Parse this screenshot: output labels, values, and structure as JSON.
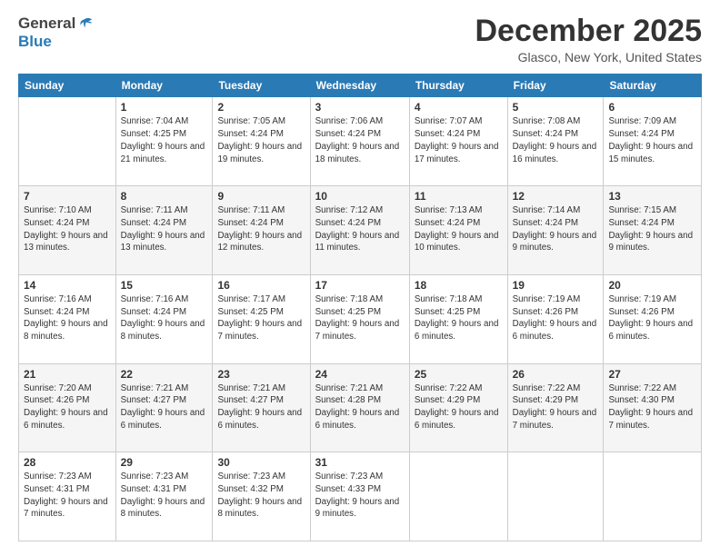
{
  "header": {
    "logo_line1": "General",
    "logo_line2": "Blue",
    "month_title": "December 2025",
    "location": "Glasco, New York, United States"
  },
  "days_of_week": [
    "Sunday",
    "Monday",
    "Tuesday",
    "Wednesday",
    "Thursday",
    "Friday",
    "Saturday"
  ],
  "weeks": [
    [
      {
        "day": "",
        "sunrise": "",
        "sunset": "",
        "daylight": ""
      },
      {
        "day": "1",
        "sunrise": "Sunrise: 7:04 AM",
        "sunset": "Sunset: 4:25 PM",
        "daylight": "Daylight: 9 hours and 21 minutes."
      },
      {
        "day": "2",
        "sunrise": "Sunrise: 7:05 AM",
        "sunset": "Sunset: 4:24 PM",
        "daylight": "Daylight: 9 hours and 19 minutes."
      },
      {
        "day": "3",
        "sunrise": "Sunrise: 7:06 AM",
        "sunset": "Sunset: 4:24 PM",
        "daylight": "Daylight: 9 hours and 18 minutes."
      },
      {
        "day": "4",
        "sunrise": "Sunrise: 7:07 AM",
        "sunset": "Sunset: 4:24 PM",
        "daylight": "Daylight: 9 hours and 17 minutes."
      },
      {
        "day": "5",
        "sunrise": "Sunrise: 7:08 AM",
        "sunset": "Sunset: 4:24 PM",
        "daylight": "Daylight: 9 hours and 16 minutes."
      },
      {
        "day": "6",
        "sunrise": "Sunrise: 7:09 AM",
        "sunset": "Sunset: 4:24 PM",
        "daylight": "Daylight: 9 hours and 15 minutes."
      }
    ],
    [
      {
        "day": "7",
        "sunrise": "Sunrise: 7:10 AM",
        "sunset": "Sunset: 4:24 PM",
        "daylight": "Daylight: 9 hours and 13 minutes."
      },
      {
        "day": "8",
        "sunrise": "Sunrise: 7:11 AM",
        "sunset": "Sunset: 4:24 PM",
        "daylight": "Daylight: 9 hours and 13 minutes."
      },
      {
        "day": "9",
        "sunrise": "Sunrise: 7:11 AM",
        "sunset": "Sunset: 4:24 PM",
        "daylight": "Daylight: 9 hours and 12 minutes."
      },
      {
        "day": "10",
        "sunrise": "Sunrise: 7:12 AM",
        "sunset": "Sunset: 4:24 PM",
        "daylight": "Daylight: 9 hours and 11 minutes."
      },
      {
        "day": "11",
        "sunrise": "Sunrise: 7:13 AM",
        "sunset": "Sunset: 4:24 PM",
        "daylight": "Daylight: 9 hours and 10 minutes."
      },
      {
        "day": "12",
        "sunrise": "Sunrise: 7:14 AM",
        "sunset": "Sunset: 4:24 PM",
        "daylight": "Daylight: 9 hours and 9 minutes."
      },
      {
        "day": "13",
        "sunrise": "Sunrise: 7:15 AM",
        "sunset": "Sunset: 4:24 PM",
        "daylight": "Daylight: 9 hours and 9 minutes."
      }
    ],
    [
      {
        "day": "14",
        "sunrise": "Sunrise: 7:16 AM",
        "sunset": "Sunset: 4:24 PM",
        "daylight": "Daylight: 9 hours and 8 minutes."
      },
      {
        "day": "15",
        "sunrise": "Sunrise: 7:16 AM",
        "sunset": "Sunset: 4:24 PM",
        "daylight": "Daylight: 9 hours and 8 minutes."
      },
      {
        "day": "16",
        "sunrise": "Sunrise: 7:17 AM",
        "sunset": "Sunset: 4:25 PM",
        "daylight": "Daylight: 9 hours and 7 minutes."
      },
      {
        "day": "17",
        "sunrise": "Sunrise: 7:18 AM",
        "sunset": "Sunset: 4:25 PM",
        "daylight": "Daylight: 9 hours and 7 minutes."
      },
      {
        "day": "18",
        "sunrise": "Sunrise: 7:18 AM",
        "sunset": "Sunset: 4:25 PM",
        "daylight": "Daylight: 9 hours and 6 minutes."
      },
      {
        "day": "19",
        "sunrise": "Sunrise: 7:19 AM",
        "sunset": "Sunset: 4:26 PM",
        "daylight": "Daylight: 9 hours and 6 minutes."
      },
      {
        "day": "20",
        "sunrise": "Sunrise: 7:19 AM",
        "sunset": "Sunset: 4:26 PM",
        "daylight": "Daylight: 9 hours and 6 minutes."
      }
    ],
    [
      {
        "day": "21",
        "sunrise": "Sunrise: 7:20 AM",
        "sunset": "Sunset: 4:26 PM",
        "daylight": "Daylight: 9 hours and 6 minutes."
      },
      {
        "day": "22",
        "sunrise": "Sunrise: 7:21 AM",
        "sunset": "Sunset: 4:27 PM",
        "daylight": "Daylight: 9 hours and 6 minutes."
      },
      {
        "day": "23",
        "sunrise": "Sunrise: 7:21 AM",
        "sunset": "Sunset: 4:27 PM",
        "daylight": "Daylight: 9 hours and 6 minutes."
      },
      {
        "day": "24",
        "sunrise": "Sunrise: 7:21 AM",
        "sunset": "Sunset: 4:28 PM",
        "daylight": "Daylight: 9 hours and 6 minutes."
      },
      {
        "day": "25",
        "sunrise": "Sunrise: 7:22 AM",
        "sunset": "Sunset: 4:29 PM",
        "daylight": "Daylight: 9 hours and 6 minutes."
      },
      {
        "day": "26",
        "sunrise": "Sunrise: 7:22 AM",
        "sunset": "Sunset: 4:29 PM",
        "daylight": "Daylight: 9 hours and 7 minutes."
      },
      {
        "day": "27",
        "sunrise": "Sunrise: 7:22 AM",
        "sunset": "Sunset: 4:30 PM",
        "daylight": "Daylight: 9 hours and 7 minutes."
      }
    ],
    [
      {
        "day": "28",
        "sunrise": "Sunrise: 7:23 AM",
        "sunset": "Sunset: 4:31 PM",
        "daylight": "Daylight: 9 hours and 7 minutes."
      },
      {
        "day": "29",
        "sunrise": "Sunrise: 7:23 AM",
        "sunset": "Sunset: 4:31 PM",
        "daylight": "Daylight: 9 hours and 8 minutes."
      },
      {
        "day": "30",
        "sunrise": "Sunrise: 7:23 AM",
        "sunset": "Sunset: 4:32 PM",
        "daylight": "Daylight: 9 hours and 8 minutes."
      },
      {
        "day": "31",
        "sunrise": "Sunrise: 7:23 AM",
        "sunset": "Sunset: 4:33 PM",
        "daylight": "Daylight: 9 hours and 9 minutes."
      },
      {
        "day": "",
        "sunrise": "",
        "sunset": "",
        "daylight": ""
      },
      {
        "day": "",
        "sunrise": "",
        "sunset": "",
        "daylight": ""
      },
      {
        "day": "",
        "sunrise": "",
        "sunset": "",
        "daylight": ""
      }
    ]
  ]
}
